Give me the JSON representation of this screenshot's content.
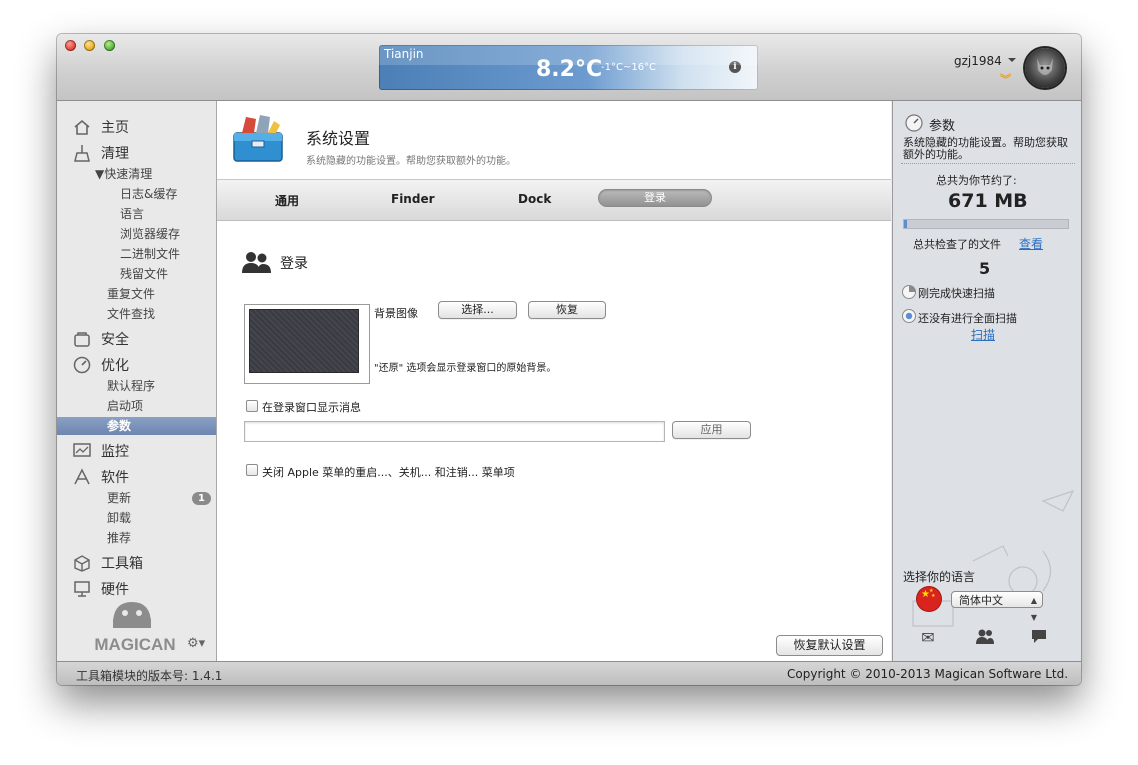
{
  "weather": {
    "city": "Tianjin",
    "temp": "8.2°C",
    "range": "-1°C~16°C",
    "info_icon": "info-icon"
  },
  "user": {
    "name": "gzj1984"
  },
  "sidebar": {
    "items": [
      {
        "label": "主页",
        "icon": "home-icon"
      },
      {
        "label": "清理",
        "icon": "broom-icon"
      },
      {
        "label": "▼快速清理"
      },
      {
        "label": "日志&缓存"
      },
      {
        "label": "语言"
      },
      {
        "label": "浏览器缓存"
      },
      {
        "label": "二进制文件"
      },
      {
        "label": "残留文件"
      },
      {
        "label": "重复文件"
      },
      {
        "label": "文件查找"
      },
      {
        "label": "安全",
        "icon": "shield-icon"
      },
      {
        "label": "优化",
        "icon": "gauge-icon"
      },
      {
        "label": "默认程序"
      },
      {
        "label": "启动项"
      },
      {
        "label": "参数"
      },
      {
        "label": "监控",
        "icon": "monitor-icon"
      },
      {
        "label": "软件",
        "icon": "appstore-icon"
      },
      {
        "label": "更新",
        "badge": "1"
      },
      {
        "label": "卸载"
      },
      {
        "label": "推荐"
      },
      {
        "label": "工具箱",
        "icon": "toolbox-icon"
      },
      {
        "label": "硬件",
        "icon": "hardware-icon"
      }
    ],
    "logo_text": "MAGICAN"
  },
  "header": {
    "title": "系统设置",
    "subtitle": "系统隐藏的功能设置。帮助您获取额外的功能。"
  },
  "tabs": [
    {
      "label": "通用"
    },
    {
      "label": "Finder"
    },
    {
      "label": "Dock"
    },
    {
      "label": "登录",
      "selected": true
    }
  ],
  "login": {
    "section_title": "登录",
    "bg_label": "背景图像",
    "choose_button": "选择...",
    "restore_button": "恢复",
    "note": "\"还原\" 选项会显示登录窗口的原始背景。",
    "show_message_label": "在登录窗口显示消息",
    "message_value": "",
    "apply_button": "应用",
    "disable_apple_label": "关闭 Apple 菜单的重启...、关机... 和注销... 菜单项"
  },
  "restore_defaults_button": "恢复默认设置",
  "right_panel": {
    "title": "参数",
    "desc": "系统隐藏的功能设置。帮助您获取额外的功能。",
    "saved_label": "总共为你节约了:",
    "saved_value": "671 MB",
    "checked_label": "总共检查了的文件",
    "view_link": "查看",
    "checked_count": "5",
    "quick_scan": "刚完成快速扫描",
    "full_scan": "还没有进行全面扫描",
    "scan_link": "扫描",
    "language_label": "选择你的语言",
    "language_value": "简体中文"
  },
  "status": {
    "version": "工具箱模块的版本号: 1.4.1",
    "copyright": "Copyright © 2010-2013 Magican Software Ltd."
  },
  "colors": {
    "accent": "#6d86b0",
    "link": "#2a6fc0",
    "weather": "#4b7fb6"
  }
}
